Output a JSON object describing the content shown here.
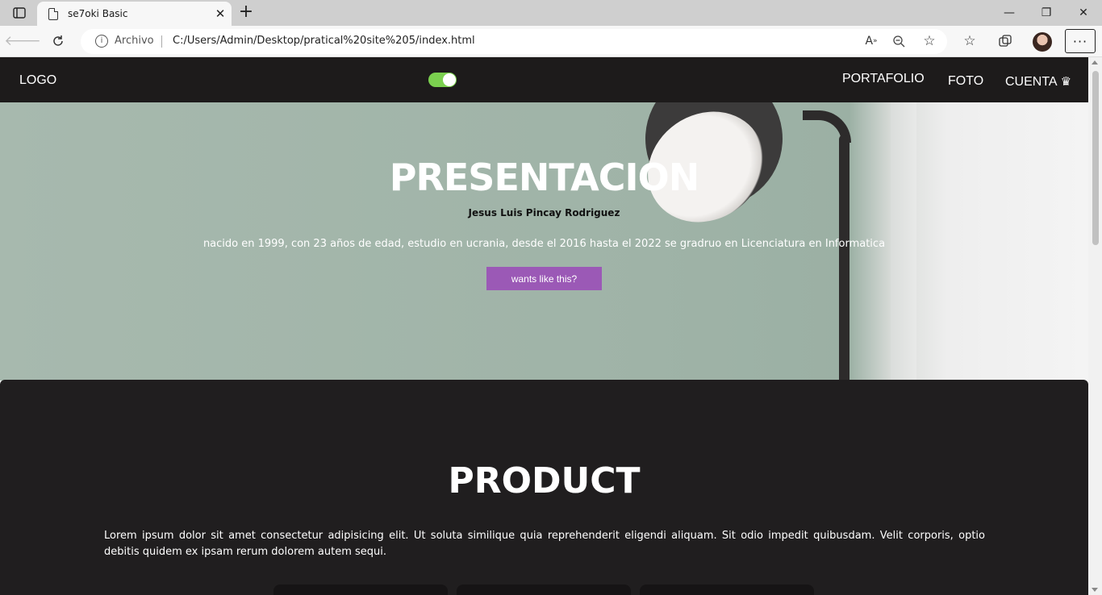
{
  "browser": {
    "tab_title": "se7oki Basic",
    "tab_close": "✕",
    "new_tab": "+",
    "address_label": "Archivo",
    "url": "C:/Users/Admin/Desktop/pratical%20site%205/index.html",
    "window_controls": [
      "—",
      "❐",
      "✕"
    ],
    "toolbar_icons": [
      "back-icon",
      "refresh-icon",
      "read-aloud-icon",
      "zoom-out-icon",
      "add-favorite-icon",
      "favorites-icon",
      "collections-icon",
      "profile-avatar",
      "more-icon"
    ]
  },
  "nav": {
    "logo": "LOGO",
    "links": [
      "PORTAFOLIO",
      "FOTO",
      "CUENTA"
    ],
    "crown": "♛",
    "toggle_state": "on",
    "toggle_color": "#7bd04f"
  },
  "hero": {
    "title": "PRESENTACION",
    "name": "Jesus Luis Pincay Rodriguez",
    "description": "nacido en 1999, con 23 años de edad, estudio en ucrania, desde el 2016 hasta el 2022 se gradruo en Licenciatura en Informatica",
    "button": "wants like this?",
    "button_color": "#9b59b6"
  },
  "product": {
    "title": "PRODUCT",
    "text": "Lorem ipsum dolor sit amet consectetur adipisicing elit. Ut soluta similique quia reprehenderit eligendi aliquam. Sit odio impedit quibusdam. Velit corporis, optio debitis quidem ex ipsam rerum dolorem autem sequi."
  }
}
